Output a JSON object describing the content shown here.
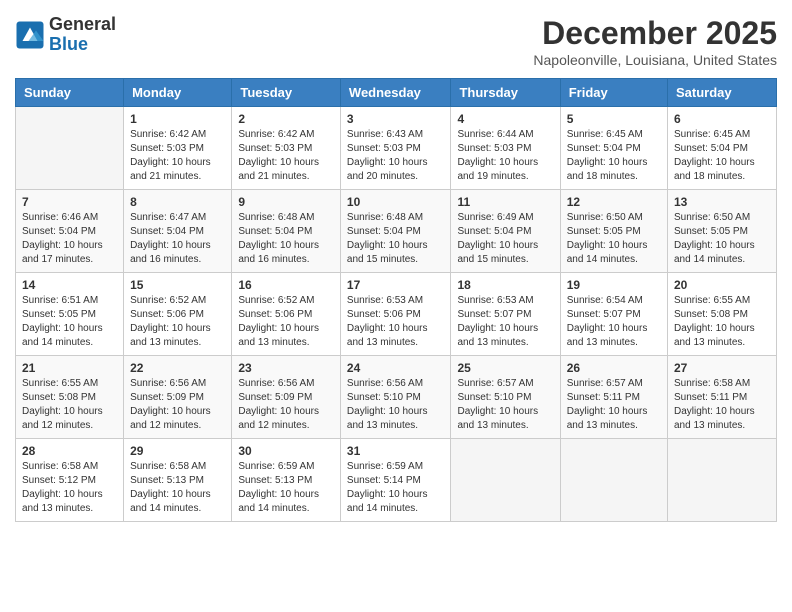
{
  "logo": {
    "general": "General",
    "blue": "Blue"
  },
  "header": {
    "month": "December 2025",
    "location": "Napoleonville, Louisiana, United States"
  },
  "weekdays": [
    "Sunday",
    "Monday",
    "Tuesday",
    "Wednesday",
    "Thursday",
    "Friday",
    "Saturday"
  ],
  "weeks": [
    [
      {
        "day": "",
        "info": ""
      },
      {
        "day": "1",
        "info": "Sunrise: 6:42 AM\nSunset: 5:03 PM\nDaylight: 10 hours\nand 21 minutes."
      },
      {
        "day": "2",
        "info": "Sunrise: 6:42 AM\nSunset: 5:03 PM\nDaylight: 10 hours\nand 21 minutes."
      },
      {
        "day": "3",
        "info": "Sunrise: 6:43 AM\nSunset: 5:03 PM\nDaylight: 10 hours\nand 20 minutes."
      },
      {
        "day": "4",
        "info": "Sunrise: 6:44 AM\nSunset: 5:03 PM\nDaylight: 10 hours\nand 19 minutes."
      },
      {
        "day": "5",
        "info": "Sunrise: 6:45 AM\nSunset: 5:04 PM\nDaylight: 10 hours\nand 18 minutes."
      },
      {
        "day": "6",
        "info": "Sunrise: 6:45 AM\nSunset: 5:04 PM\nDaylight: 10 hours\nand 18 minutes."
      }
    ],
    [
      {
        "day": "7",
        "info": "Sunrise: 6:46 AM\nSunset: 5:04 PM\nDaylight: 10 hours\nand 17 minutes."
      },
      {
        "day": "8",
        "info": "Sunrise: 6:47 AM\nSunset: 5:04 PM\nDaylight: 10 hours\nand 16 minutes."
      },
      {
        "day": "9",
        "info": "Sunrise: 6:48 AM\nSunset: 5:04 PM\nDaylight: 10 hours\nand 16 minutes."
      },
      {
        "day": "10",
        "info": "Sunrise: 6:48 AM\nSunset: 5:04 PM\nDaylight: 10 hours\nand 15 minutes."
      },
      {
        "day": "11",
        "info": "Sunrise: 6:49 AM\nSunset: 5:04 PM\nDaylight: 10 hours\nand 15 minutes."
      },
      {
        "day": "12",
        "info": "Sunrise: 6:50 AM\nSunset: 5:05 PM\nDaylight: 10 hours\nand 14 minutes."
      },
      {
        "day": "13",
        "info": "Sunrise: 6:50 AM\nSunset: 5:05 PM\nDaylight: 10 hours\nand 14 minutes."
      }
    ],
    [
      {
        "day": "14",
        "info": "Sunrise: 6:51 AM\nSunset: 5:05 PM\nDaylight: 10 hours\nand 14 minutes."
      },
      {
        "day": "15",
        "info": "Sunrise: 6:52 AM\nSunset: 5:06 PM\nDaylight: 10 hours\nand 13 minutes."
      },
      {
        "day": "16",
        "info": "Sunrise: 6:52 AM\nSunset: 5:06 PM\nDaylight: 10 hours\nand 13 minutes."
      },
      {
        "day": "17",
        "info": "Sunrise: 6:53 AM\nSunset: 5:06 PM\nDaylight: 10 hours\nand 13 minutes."
      },
      {
        "day": "18",
        "info": "Sunrise: 6:53 AM\nSunset: 5:07 PM\nDaylight: 10 hours\nand 13 minutes."
      },
      {
        "day": "19",
        "info": "Sunrise: 6:54 AM\nSunset: 5:07 PM\nDaylight: 10 hours\nand 13 minutes."
      },
      {
        "day": "20",
        "info": "Sunrise: 6:55 AM\nSunset: 5:08 PM\nDaylight: 10 hours\nand 13 minutes."
      }
    ],
    [
      {
        "day": "21",
        "info": "Sunrise: 6:55 AM\nSunset: 5:08 PM\nDaylight: 10 hours\nand 12 minutes."
      },
      {
        "day": "22",
        "info": "Sunrise: 6:56 AM\nSunset: 5:09 PM\nDaylight: 10 hours\nand 12 minutes."
      },
      {
        "day": "23",
        "info": "Sunrise: 6:56 AM\nSunset: 5:09 PM\nDaylight: 10 hours\nand 12 minutes."
      },
      {
        "day": "24",
        "info": "Sunrise: 6:56 AM\nSunset: 5:10 PM\nDaylight: 10 hours\nand 13 minutes."
      },
      {
        "day": "25",
        "info": "Sunrise: 6:57 AM\nSunset: 5:10 PM\nDaylight: 10 hours\nand 13 minutes."
      },
      {
        "day": "26",
        "info": "Sunrise: 6:57 AM\nSunset: 5:11 PM\nDaylight: 10 hours\nand 13 minutes."
      },
      {
        "day": "27",
        "info": "Sunrise: 6:58 AM\nSunset: 5:11 PM\nDaylight: 10 hours\nand 13 minutes."
      }
    ],
    [
      {
        "day": "28",
        "info": "Sunrise: 6:58 AM\nSunset: 5:12 PM\nDaylight: 10 hours\nand 13 minutes."
      },
      {
        "day": "29",
        "info": "Sunrise: 6:58 AM\nSunset: 5:13 PM\nDaylight: 10 hours\nand 14 minutes."
      },
      {
        "day": "30",
        "info": "Sunrise: 6:59 AM\nSunset: 5:13 PM\nDaylight: 10 hours\nand 14 minutes."
      },
      {
        "day": "31",
        "info": "Sunrise: 6:59 AM\nSunset: 5:14 PM\nDaylight: 10 hours\nand 14 minutes."
      },
      {
        "day": "",
        "info": ""
      },
      {
        "day": "",
        "info": ""
      },
      {
        "day": "",
        "info": ""
      }
    ]
  ]
}
